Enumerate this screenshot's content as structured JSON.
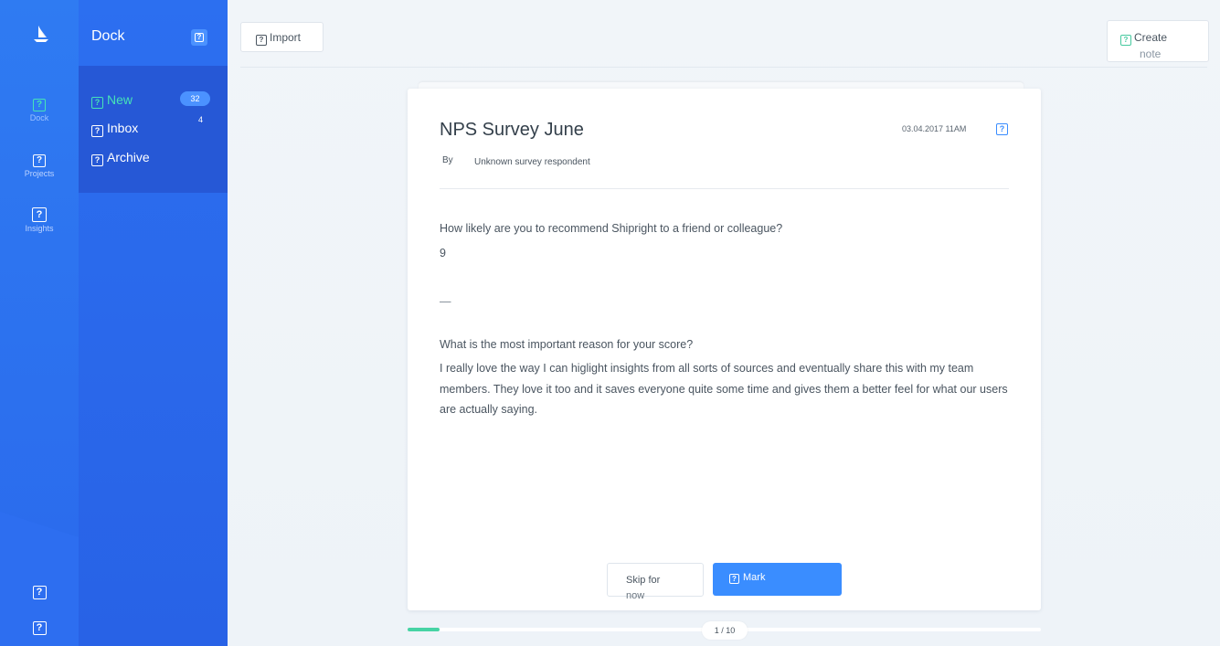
{
  "rail": {
    "items": [
      {
        "label": "Dock",
        "icon": "dock-icon"
      },
      {
        "label": "Projects",
        "icon": "projects-icon"
      },
      {
        "label": "Insights",
        "icon": "insights-icon"
      }
    ],
    "icon_glyph": "?"
  },
  "dock": {
    "title": "Dock",
    "items": [
      {
        "label": "New",
        "count": "32"
      },
      {
        "label": "Inbox",
        "count": "4"
      },
      {
        "label": "Archive"
      }
    ]
  },
  "toolbar": {
    "import_label": "Import",
    "create_label_line1": "Create",
    "create_label_line2": "note"
  },
  "note": {
    "title": "NPS Survey June",
    "date": "03.04.2017 11AM",
    "by_label": "By",
    "author": "Unknown survey respondent",
    "question1": "How likely are you to recommend Shipright to a friend or colleague?",
    "answer1": "9",
    "separator": "—",
    "question2": "What is the most important reason for your score?",
    "answer2": "I really love the way I can higlight insights from all sorts of sources and eventually share this with my team members. They love it too and it saves everyone quite some time and gives them a better feel for what our users are actually saying."
  },
  "actions": {
    "skip_line1": "Skip for",
    "skip_line2": "now",
    "mark_label": "Mark"
  },
  "progress": {
    "label": "1 / 10",
    "current": 1,
    "total": 10
  },
  "colors": {
    "accent": "#3a8dff",
    "active_green": "#46e3b7",
    "rail_blue": "#2f7bf2"
  }
}
